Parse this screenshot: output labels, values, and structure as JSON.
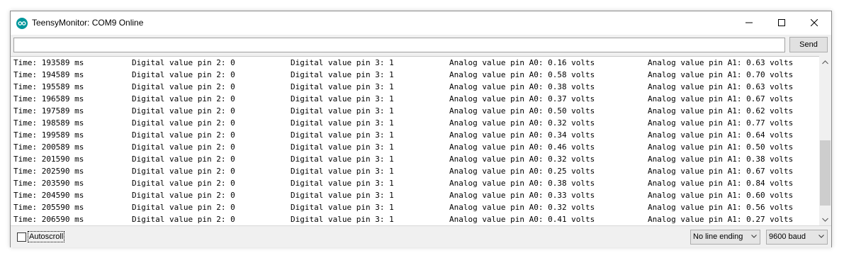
{
  "window": {
    "title": "TeensyMonitor: COM9 Online"
  },
  "send_bar": {
    "input_value": "",
    "send_label": "Send"
  },
  "log": {
    "rows": [
      {
        "time": "Time: 193589 ms",
        "d2": "Digital value pin 2: 0",
        "d3": "Digital value pin 3: 1",
        "a0": "Analog value pin A0: 0.16 volts",
        "a1": "Analog value pin A1: 0.63 volts"
      },
      {
        "time": "Time: 194589 ms",
        "d2": "Digital value pin 2: 0",
        "d3": "Digital value pin 3: 1",
        "a0": "Analog value pin A0: 0.58 volts",
        "a1": "Analog value pin A1: 0.70 volts"
      },
      {
        "time": "Time: 195589 ms",
        "d2": "Digital value pin 2: 0",
        "d3": "Digital value pin 3: 1",
        "a0": "Analog value pin A0: 0.38 volts",
        "a1": "Analog value pin A1: 0.63 volts"
      },
      {
        "time": "Time: 196589 ms",
        "d2": "Digital value pin 2: 0",
        "d3": "Digital value pin 3: 1",
        "a0": "Analog value pin A0: 0.37 volts",
        "a1": "Analog value pin A1: 0.67 volts"
      },
      {
        "time": "Time: 197589 ms",
        "d2": "Digital value pin 2: 0",
        "d3": "Digital value pin 3: 1",
        "a0": "Analog value pin A0: 0.50 volts",
        "a1": "Analog value pin A1: 0.62 volts"
      },
      {
        "time": "Time: 198589 ms",
        "d2": "Digital value pin 2: 0",
        "d3": "Digital value pin 3: 1",
        "a0": "Analog value pin A0: 0.32 volts",
        "a1": "Analog value pin A1: 0.77 volts"
      },
      {
        "time": "Time: 199589 ms",
        "d2": "Digital value pin 2: 0",
        "d3": "Digital value pin 3: 1",
        "a0": "Analog value pin A0: 0.34 volts",
        "a1": "Analog value pin A1: 0.64 volts"
      },
      {
        "time": "Time: 200589 ms",
        "d2": "Digital value pin 2: 0",
        "d3": "Digital value pin 3: 1",
        "a0": "Analog value pin A0: 0.46 volts",
        "a1": "Analog value pin A1: 0.50 volts"
      },
      {
        "time": "Time: 201590 ms",
        "d2": "Digital value pin 2: 0",
        "d3": "Digital value pin 3: 1",
        "a0": "Analog value pin A0: 0.32 volts",
        "a1": "Analog value pin A1: 0.38 volts"
      },
      {
        "time": "Time: 202590 ms",
        "d2": "Digital value pin 2: 0",
        "d3": "Digital value pin 3: 1",
        "a0": "Analog value pin A0: 0.25 volts",
        "a1": "Analog value pin A1: 0.67 volts"
      },
      {
        "time": "Time: 203590 ms",
        "d2": "Digital value pin 2: 0",
        "d3": "Digital value pin 3: 1",
        "a0": "Analog value pin A0: 0.38 volts",
        "a1": "Analog value pin A1: 0.84 volts"
      },
      {
        "time": "Time: 204590 ms",
        "d2": "Digital value pin 2: 0",
        "d3": "Digital value pin 3: 1",
        "a0": "Analog value pin A0: 0.33 volts",
        "a1": "Analog value pin A1: 0.60 volts"
      },
      {
        "time": "Time: 205590 ms",
        "d2": "Digital value pin 2: 0",
        "d3": "Digital value pin 3: 1",
        "a0": "Analog value pin A0: 0.32 volts",
        "a1": "Analog value pin A1: 0.56 volts"
      },
      {
        "time": "Time: 206590 ms",
        "d2": "Digital value pin 2: 0",
        "d3": "Digital value pin 3: 1",
        "a0": "Analog value pin A0: 0.41 volts",
        "a1": "Analog value pin A1: 0.27 volts"
      }
    ]
  },
  "scrollbar": {
    "position_fraction": 0.9,
    "visible_fraction": 0.45
  },
  "bottom_bar": {
    "autoscroll_label": "Autoscroll",
    "autoscroll_checked": false,
    "line_ending": "No line ending",
    "baud_rate": "9600 baud"
  },
  "icons": {
    "app": "teensy-infinity-icon",
    "minimize": "minimize-icon",
    "maximize": "maximize-icon",
    "close": "close-icon",
    "scroll_up": "chevron-up-icon",
    "scroll_down": "chevron-down-icon",
    "dropdown": "chevron-down-icon"
  },
  "colors": {
    "brand": "#00979c"
  }
}
